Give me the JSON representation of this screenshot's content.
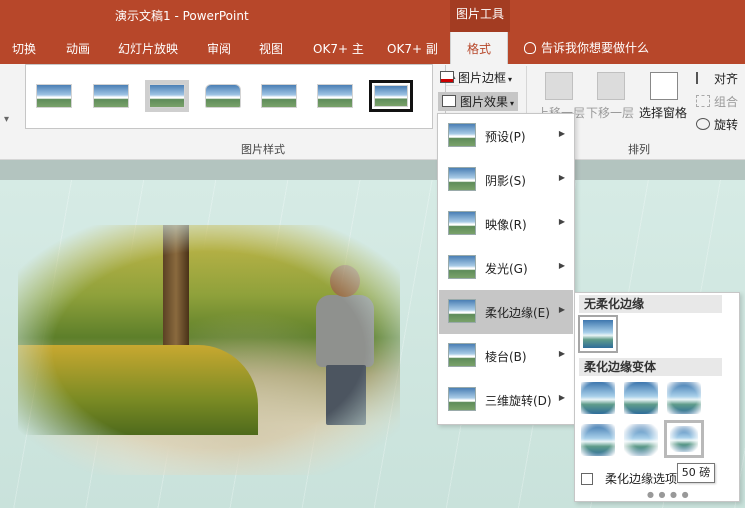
{
  "titlebar": {
    "document_title": "演示文稿1  -  PowerPoint",
    "context_tool": "图片工具"
  },
  "tabs": {
    "items": [
      {
        "label": "切换"
      },
      {
        "label": "动画"
      },
      {
        "label": "幻灯片放映"
      },
      {
        "label": "审阅"
      },
      {
        "label": "视图"
      },
      {
        "label": "OK7+ 主"
      },
      {
        "label": "OK7+ 副"
      },
      {
        "label": "格式"
      }
    ],
    "active": "格式",
    "tell_me": "告诉我你想要做什么"
  },
  "ribbon": {
    "picture_styles_label": "图片样式",
    "picture_border": "图片边框",
    "picture_effects": "图片效果",
    "bring_forward": "上移一层",
    "send_backward": "下移一层",
    "selection_pane": "选择窗格",
    "align": "对齐",
    "group": "组合",
    "rotate": "旋转",
    "arrange_label": "排列",
    "style_thumbnail_count": 7,
    "selected_style_index": 6
  },
  "effects_menu": {
    "items": [
      {
        "label": "预设(P)"
      },
      {
        "label": "阴影(S)"
      },
      {
        "label": "映像(R)"
      },
      {
        "label": "发光(G)"
      },
      {
        "label": "柔化边缘(E)"
      },
      {
        "label": "棱台(B)"
      },
      {
        "label": "三维旋转(D)"
      }
    ],
    "hovered": "柔化边缘(E)"
  },
  "soft_edges_menu": {
    "no_soft_edge_header": "无柔化边缘",
    "variants_header": "柔化边缘变体",
    "options_label": "柔化边缘选项",
    "variant_count": 6
  },
  "tooltip": {
    "text": "50 磅"
  },
  "colors": {
    "accent": "#b7472a",
    "ribbon_bg": "#f3f3f3",
    "slide_bg": "#cfe5df"
  }
}
